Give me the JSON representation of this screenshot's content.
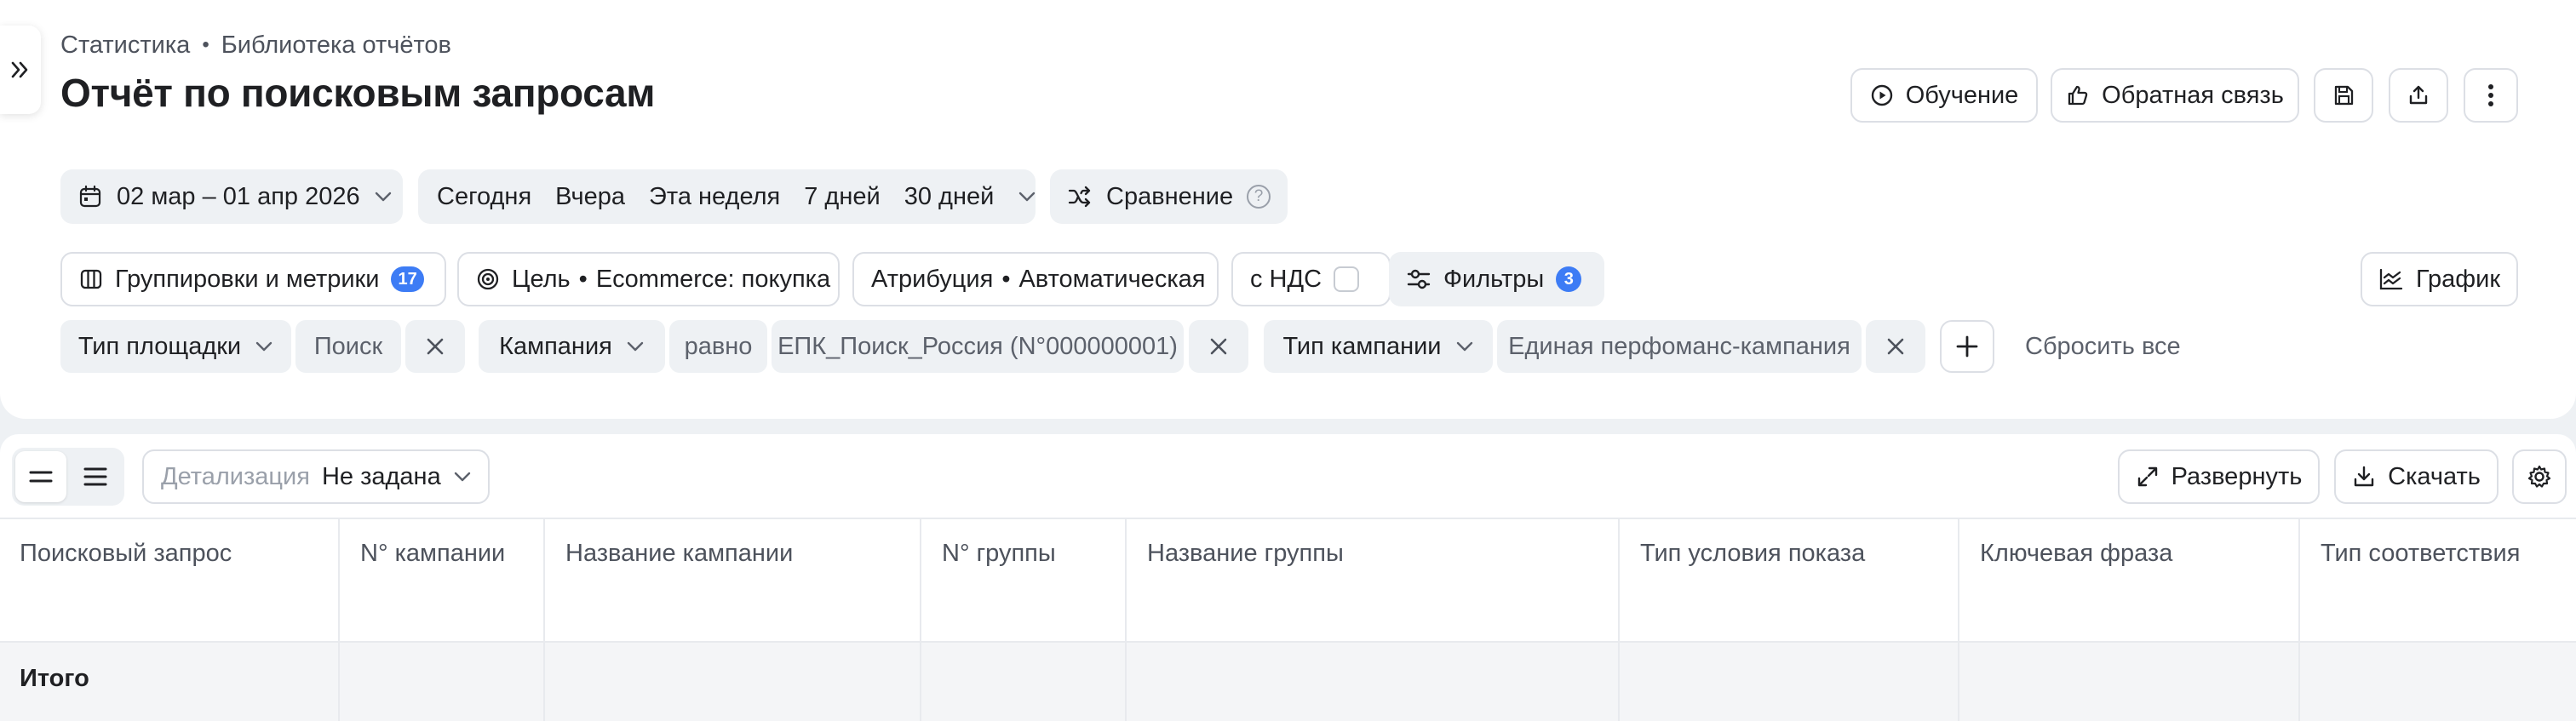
{
  "breadcrumb": {
    "root": "Статистика",
    "separator": "•",
    "current": "Библиотека отчётов"
  },
  "page_title": "Отчёт по поисковым запросам",
  "header_actions": {
    "learning_label": "Обучение",
    "feedback_label": "Обратная связь"
  },
  "period": {
    "date_range": "02 мар – 01 апр 2026",
    "presets": [
      "Сегодня",
      "Вчера",
      "Эта неделя",
      "7 дней",
      "30 дней"
    ],
    "comparison_label": "Сравнение",
    "comparison_help": "?"
  },
  "settings_bar": {
    "groupings_label": "Группировки и метрики",
    "groupings_count": "17",
    "goal_label": "Цель",
    "goal_value": "Ecommerce: покупка",
    "attribution_label": "Атрибуция",
    "attribution_value": "Автоматическая",
    "vat_label": "с НДС",
    "filters_label": "Фильтры",
    "filters_count": "3",
    "chart_label": "График",
    "dot": "•"
  },
  "filters": [
    {
      "field": "Тип площадки",
      "value": "Поиск"
    },
    {
      "field": "Кампания",
      "operator": "равно",
      "value": "ЕПК_Поиск_Россия (N°000000001)"
    },
    {
      "field": "Тип кампании",
      "value": "Единая перфоманс-кампания"
    }
  ],
  "reset_all_label": "Сбросить все",
  "table_toolbar": {
    "detail_label": "Детализация",
    "detail_value": "Не задана",
    "expand_label": "Развернуть",
    "download_label": "Скачать"
  },
  "table": {
    "columns": [
      "Поисковый запрос",
      "N° кампании",
      "Название кампании",
      "N° группы",
      "Название группы",
      "Тип условия показа",
      "Ключевая фраза",
      "Тип соответствия"
    ],
    "total_label": "Итого"
  },
  "colors": {
    "accent": "#3d7cf5",
    "chip_bg": "#eef1f4",
    "border": "#dcdfe5",
    "text": "#1f2023",
    "muted": "#5c616b"
  }
}
